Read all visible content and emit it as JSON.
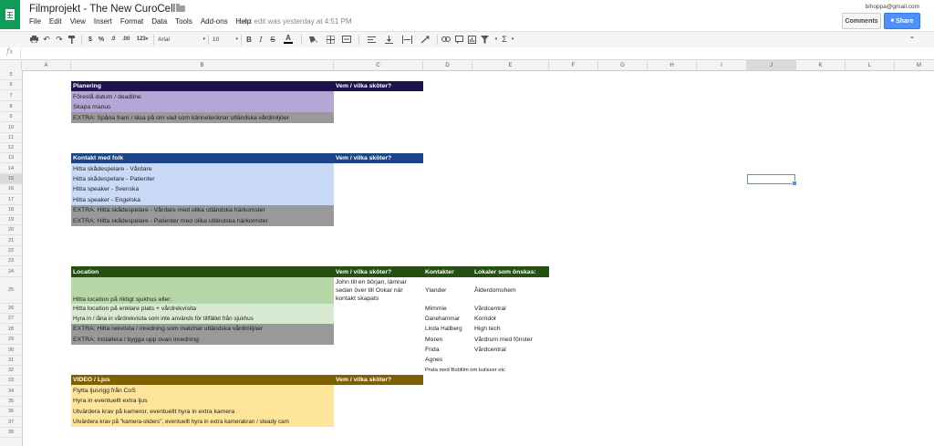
{
  "app": {
    "title": "Filmprojekt - The New CuroCell",
    "last_edit": "Last edit was yesterday at 4:51 PM",
    "user_email": "bihoppa@gmail.com",
    "comments_label": "Comments",
    "share_label": "Share",
    "menu": [
      "File",
      "Edit",
      "View",
      "Insert",
      "Format",
      "Data",
      "Tools",
      "Add-ons",
      "Help"
    ]
  },
  "toolbar": {
    "currency": "$",
    "percent": "%",
    "dec_less": ".0",
    "dec_more": ".00",
    "number_format": "123",
    "font": "Arial",
    "font_size": "10",
    "bold": "B",
    "italic": "I",
    "strike": "S",
    "text_color": "A"
  },
  "formula": {
    "fx": "fx"
  },
  "columns": [
    "A",
    "B",
    "C",
    "D",
    "E",
    "F",
    "G",
    "H",
    "I",
    "J",
    "K",
    "L",
    "M"
  ],
  "rows": [
    "5",
    "6",
    "7",
    "8",
    "9",
    "10",
    "11",
    "12",
    "13",
    "14",
    "15",
    "16",
    "17",
    "18",
    "19",
    "20",
    "21",
    "22",
    "23",
    "24",
    "25",
    "26",
    "27",
    "28",
    "29",
    "30",
    "31",
    "32",
    "33",
    "34",
    "35",
    "36",
    "37",
    "38"
  ],
  "colors": {
    "planering_head": "#20124d",
    "planering_fill": "#b4a7d6",
    "kontakt_head": "#1c4587",
    "kontakt_fill": "#c9daf8",
    "location_head": "#274e13",
    "location_fill": "#b6d7a8",
    "location_light": "#d9ead3",
    "video_head": "#7f6000",
    "video_fill": "#ffe599",
    "extra_fill": "#999999"
  },
  "planering": {
    "header": "Planering",
    "who": "Vem / vilka sköter?",
    "items": [
      "Föreslå datum / deadline",
      "Skapa manus",
      "EXTRA: Spåna fram / läsa på om vad som kännetecknar utländska vårdmiljöer"
    ]
  },
  "kontakt": {
    "header": "Kontakt med folk",
    "who": "Vem / vilka sköter?",
    "items": [
      "Hitta skådespelare - Vårdare",
      "Hitta skådespelare - Patienter",
      "Hitta speaker - Svenska",
      "Hitta speaker - Engelska",
      "EXTRA: Hitta skådespelare - Vårdare med olika utländska härkomster",
      "EXTRA: Hitta skådespelare - Patienter med olika utländska härkomster"
    ]
  },
  "location": {
    "header": "Location",
    "who": "Vem / vilka sköter?",
    "contacts_head": "Kontakter",
    "venues_head": "Lokaler som önskas:",
    "items": [
      "Hitta location på riktigt sjukhus eller:",
      "Hitta location på enklare plats + vårdrekvisita",
      "Hyra in / låna in vårdrekvisita som inte används för tillfället från sjukhus",
      "EXTRA: Hitta rekvisita / inredning som matchar utländska vårdmiljöer",
      "EXTRA: Installera / bygga upp ovan inredning"
    ],
    "who_note": [
      "John till en början, lämnar",
      "sedan över till Oskar när",
      "kontakt skapats"
    ],
    "contacts": [
      "Ylander",
      "Mimmie",
      "Danehammar",
      "Linda Hallberg",
      "Moren",
      "Frida",
      "Agnes",
      "Prata med Bobfilm om kulisser etc"
    ],
    "venues": [
      "Ålderdomshem",
      "Vårdcentral",
      "Korridor",
      "High tech",
      "Vårdrum med fönster",
      "Vårdcentral"
    ]
  },
  "video": {
    "header": "VIDEO / Ljus",
    "who": "Vem / vilka sköter?",
    "items": [
      "Flytta ljusrigg från CoS",
      "Hyra in eventuellt extra ljus",
      "Utvärdera krav på kameror, eventuellt hyra in extra kamera",
      "Utvärdera krav på \"kamera-sliders\", eventuellt hyra in extra kamerakran / steady cam"
    ]
  }
}
